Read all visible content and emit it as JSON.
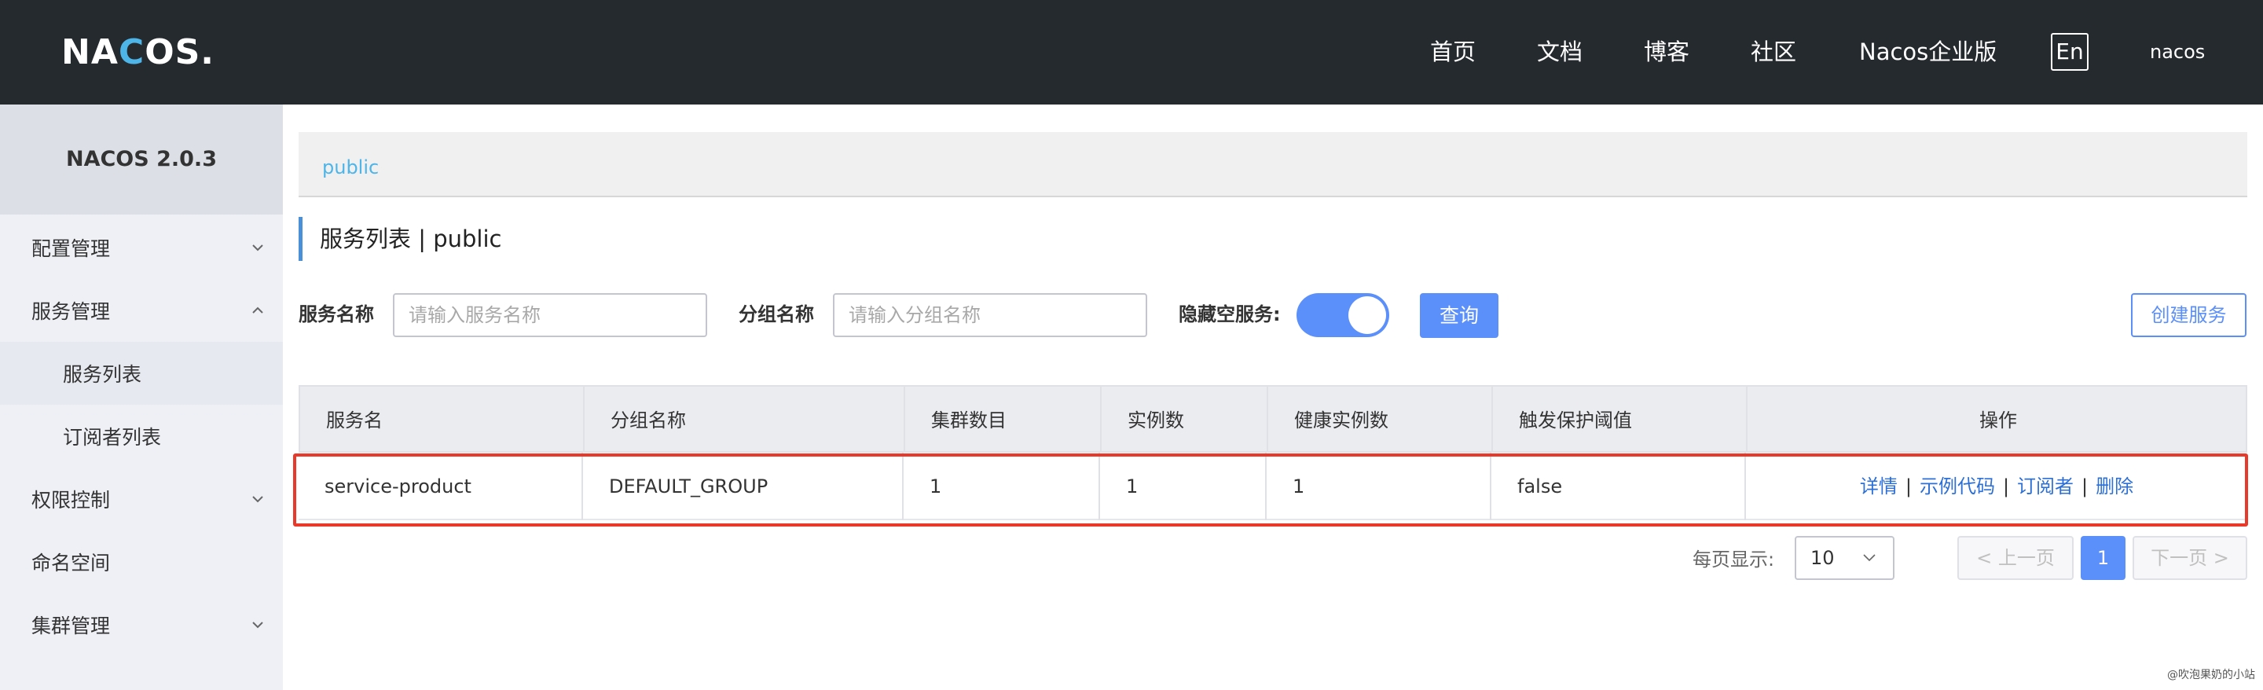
{
  "header": {
    "logo_text_a": "NA",
    "logo_text_b": "C",
    "logo_text_c": "OS.",
    "nav": [
      "首页",
      "文档",
      "博客",
      "社区",
      "Nacos企业版"
    ],
    "lang": "En",
    "user": "nacos"
  },
  "sidebar": {
    "title": "NACOS 2.0.3",
    "items": [
      {
        "label": "配置管理"
      },
      {
        "label": "服务管理"
      },
      {
        "label": "服务列表"
      },
      {
        "label": "订阅者列表"
      },
      {
        "label": "权限控制"
      },
      {
        "label": "命名空间"
      },
      {
        "label": "集群管理"
      }
    ]
  },
  "namespace": {
    "link": "public"
  },
  "page": {
    "title": "服务列表  |  public"
  },
  "filters": {
    "service_label": "服务名称",
    "service_placeholder": "请输入服务名称",
    "group_label": "分组名称",
    "group_placeholder": "请输入分组名称",
    "hide_empty_label": "隐藏空服务:",
    "hide_empty_on": true,
    "query_button": "查询",
    "create_button": "创建服务"
  },
  "table": {
    "headers": [
      "服务名",
      "分组名称",
      "集群数目",
      "实例数",
      "健康实例数",
      "触发保护阈值",
      "操作"
    ],
    "rows": [
      {
        "service": "service-product",
        "group": "DEFAULT_GROUP",
        "clusters": "1",
        "instances": "1",
        "healthy": "1",
        "threshold": "false",
        "ops": [
          "详情",
          "示例代码",
          "订阅者",
          "删除"
        ]
      }
    ]
  },
  "pagination": {
    "per_page_label": "每页显示:",
    "per_page_value": "10",
    "prev": "上一页",
    "current": "1",
    "next": "下一页"
  },
  "colors": {
    "accent": "#5b8ff9",
    "header_bg": "#252a2f",
    "highlight": "#e8392a"
  },
  "watermark": "@吹泡果奶的小站"
}
